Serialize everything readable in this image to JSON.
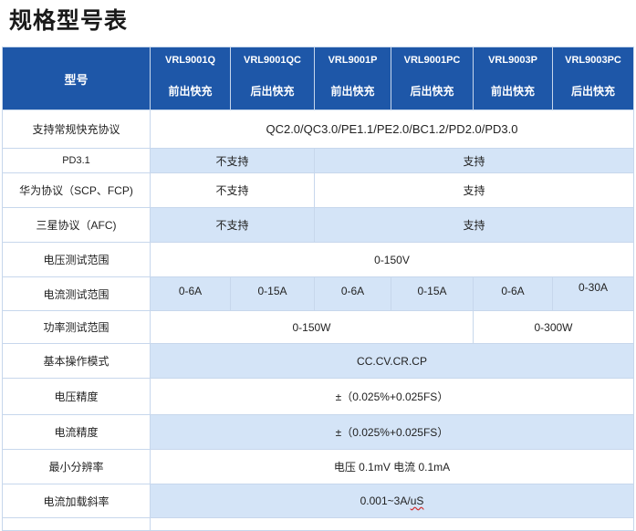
{
  "title": "规格型号表",
  "header": {
    "model_label": "型号",
    "models": [
      {
        "name": "VRL9001Q",
        "type": "前出快充"
      },
      {
        "name": "VRL9001QC",
        "type": "后出快充"
      },
      {
        "name": "VRL9001P",
        "type": "前出快充"
      },
      {
        "name": "VRL9001PC",
        "type": "后出快充"
      },
      {
        "name": "VRL9003P",
        "type": "前出快充"
      },
      {
        "name": "VRL9003PC",
        "type": "后出快充"
      }
    ]
  },
  "rows": {
    "protocol": {
      "label": "支持常规快充协议",
      "value": "QC2.0/QC3.0/PE1.1/PE2.0/BC1.2/PD2.0/PD3.0"
    },
    "pd31": {
      "label": "PD3.1",
      "q": "不支持",
      "p": "支持"
    },
    "huawei": {
      "label": "华为协议（SCP、FCP)",
      "q": "不支持",
      "p": "支持"
    },
    "samsung": {
      "label": "三星协议（AFC)",
      "q": "不支持",
      "p": "支持"
    },
    "voltage_range": {
      "label": "电压测试范围",
      "value": "0-150V"
    },
    "current_range": {
      "label": "电流测试范围",
      "values": [
        "0-6A",
        "0-15A",
        "0-6A",
        "0-15A",
        "0-6A",
        "0-30A"
      ]
    },
    "power_range": {
      "label": "功率测试范围",
      "v9001": "0-150W",
      "v9003": "0-300W"
    },
    "modes": {
      "label": "基本操作模式",
      "value": "CC.CV.CR.CP"
    },
    "voltage_accuracy": {
      "label": "电压精度",
      "value": "±（0.025%+0.025FS）"
    },
    "current_accuracy": {
      "label": "电流精度",
      "value": "±（0.025%+0.025FS）"
    },
    "resolution": {
      "label": "最小分辨率",
      "value": "电压 0.1mV 电流 0.1mA"
    },
    "slew_rate": {
      "label": "电流加载斜率",
      "value_main": "0.001~3A/",
      "value_unit": "uS"
    }
  },
  "colors": {
    "header_bg": "#1e57a8",
    "band_bg": "#d4e4f7",
    "border": "#c7d7ec"
  }
}
